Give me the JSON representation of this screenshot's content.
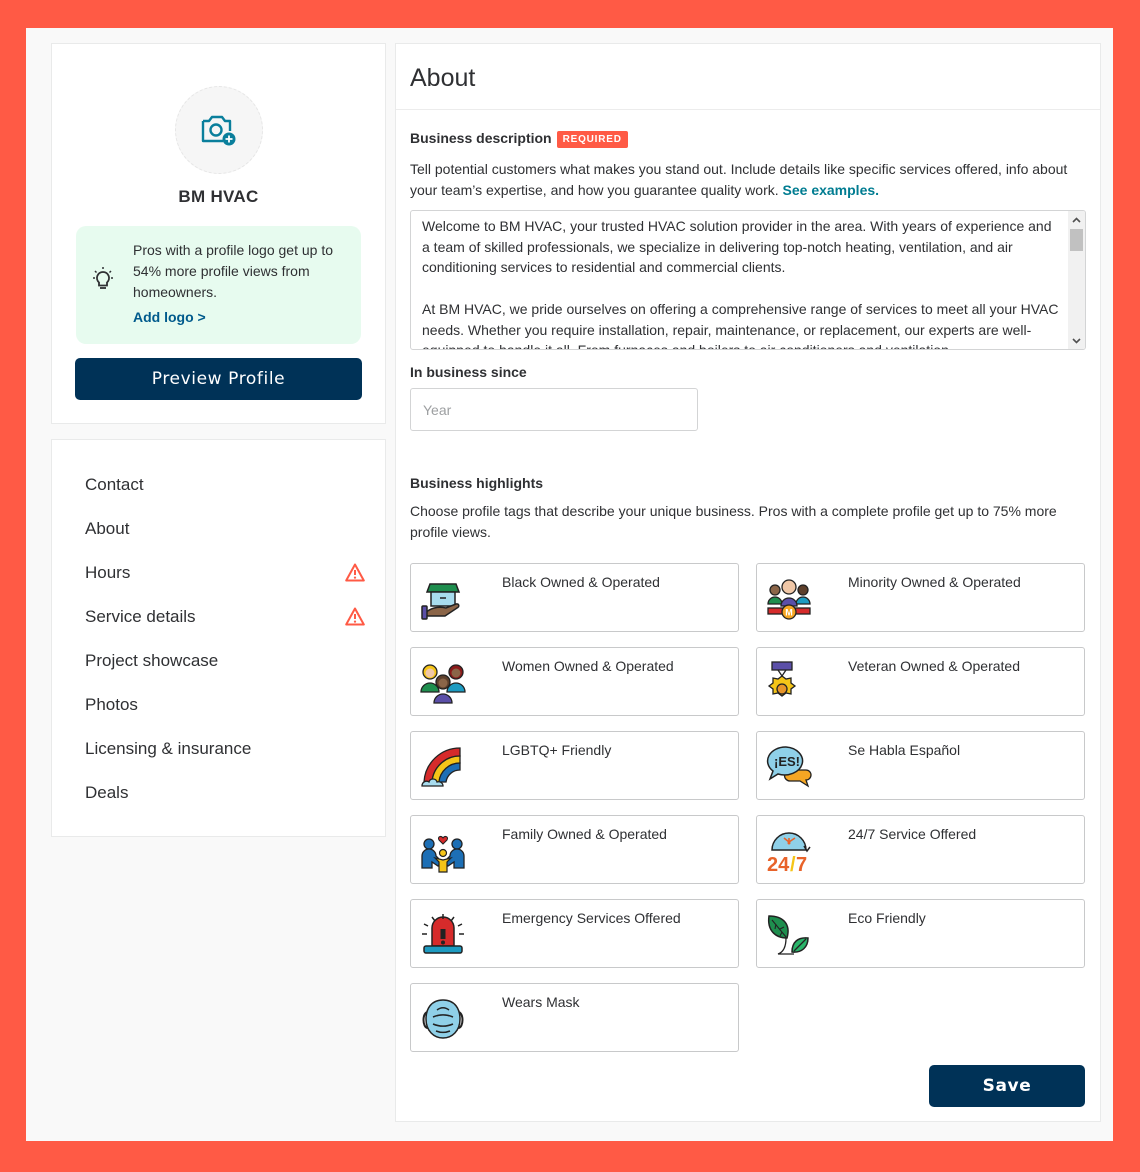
{
  "profile": {
    "business_name": "BM HVAC",
    "tip_text": "Pros with a profile logo get up to 54% more profile views from homeowners.",
    "tip_link": "Add logo >",
    "preview_button": "Preview Profile"
  },
  "nav": {
    "items": [
      {
        "label": "Contact",
        "warning": false
      },
      {
        "label": "About",
        "warning": false
      },
      {
        "label": "Hours",
        "warning": true
      },
      {
        "label": "Service details",
        "warning": true
      },
      {
        "label": "Project showcase",
        "warning": false
      },
      {
        "label": "Photos",
        "warning": false
      },
      {
        "label": "Licensing & insurance",
        "warning": false
      },
      {
        "label": "Deals",
        "warning": false
      }
    ]
  },
  "main": {
    "title": "About",
    "description": {
      "label": "Business description",
      "badge": "REQUIRED",
      "help": "Tell potential customers what makes you stand out. Include details like specific services offered, info about your team’s expertise, and how you guarantee quality work.",
      "help_link": "See examples.",
      "value": "Welcome to BM HVAC, your trusted HVAC solution provider in the area. With years of experience and a team of skilled professionals, we specialize in delivering top-notch heating, ventilation, and air conditioning services to residential and commercial clients.\n\nAt BM HVAC, we pride ourselves on offering a comprehensive range of services to meet all your HVAC needs. Whether you require installation, repair, maintenance, or replacement, our experts are well-equipped to handle it all. From furnaces and boilers to air conditioners and ventilation"
    },
    "in_business_since": {
      "label": "In business since",
      "placeholder": "Year",
      "value": ""
    },
    "highlights": {
      "label": "Business highlights",
      "help": "Choose profile tags that describe your unique business. Pros with a complete profile get up to 75% more profile views.",
      "items": [
        {
          "label": "Black Owned & Operated",
          "icon": "hand-shop-icon"
        },
        {
          "label": "Minority Owned & Operated",
          "icon": "people-medal-icon"
        },
        {
          "label": "Women Owned & Operated",
          "icon": "women-group-icon"
        },
        {
          "label": "Veteran Owned & Operated",
          "icon": "medal-icon"
        },
        {
          "label": "LGBTQ+ Friendly",
          "icon": "rainbow-icon"
        },
        {
          "label": "Se Habla Español",
          "icon": "speech-bubble-es-icon"
        },
        {
          "label": "Family Owned & Operated",
          "icon": "family-icon"
        },
        {
          "label": "24/7 Service Offered",
          "icon": "clock-24-7-icon"
        },
        {
          "label": "Emergency Services Offered",
          "icon": "siren-icon"
        },
        {
          "label": "Eco Friendly",
          "icon": "leaves-icon"
        },
        {
          "label": "Wears Mask",
          "icon": "face-mask-icon"
        }
      ]
    },
    "save_button": "Save"
  },
  "colors": {
    "frame": "#ff5a45",
    "primary": "#003257",
    "required_badge": "#ff5a45",
    "link": "#007c91",
    "tip_bg": "#e7fbef",
    "warning": "#ff5a45"
  }
}
